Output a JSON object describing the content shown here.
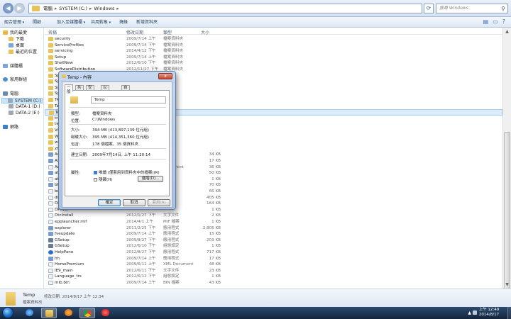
{
  "address": {
    "crumbs": [
      "電腦",
      "SYSTEM (C:)",
      "Windows"
    ],
    "search_placeholder": "搜尋 Windows"
  },
  "toolbar": {
    "items": [
      "組合管理",
      "開啟",
      "加入至媒體櫃",
      "共用對象",
      "燒錄",
      "新增資料夾"
    ]
  },
  "nav": {
    "favorites": "我的最愛",
    "fav_items": [
      "下載",
      "桌面",
      "最近的位置"
    ],
    "libraries": "媒體櫃",
    "homegroup": "家用群組",
    "computer": "電腦",
    "drives": [
      "SYSTEM (C:)",
      "DATA-1 (D:)",
      "DATA-2 (E:)"
    ],
    "network": "網路"
  },
  "columns": [
    "名稱",
    "修改日期",
    "類型",
    "大小"
  ],
  "files": [
    {
      "name": "security",
      "date": "2009/7/14 上午",
      "type": "檔案資料夾",
      "size": "",
      "icon": "folder"
    },
    {
      "name": "ServiceProfiles",
      "date": "2009/7/14 下午",
      "type": "檔案資料夾",
      "size": "",
      "icon": "folder"
    },
    {
      "name": "servicing",
      "date": "2014/4/12 下午",
      "type": "檔案資料夾",
      "size": "",
      "icon": "folder"
    },
    {
      "name": "Setup",
      "date": "2009/7/14 上午",
      "type": "檔案資料夾",
      "size": "",
      "icon": "folder"
    },
    {
      "name": "ShellNew",
      "date": "2012/6/10 下午",
      "type": "檔案資料夾",
      "size": "",
      "icon": "folder"
    },
    {
      "name": "SoftwareDistribution",
      "date": "2012/11/27 下午",
      "type": "檔案資料夾",
      "size": "",
      "icon": "folder"
    },
    {
      "name": "Speech",
      "date": "",
      "type": "",
      "size": "",
      "icon": "folder"
    },
    {
      "name": "System",
      "date": "",
      "type": "",
      "size": "",
      "icon": "folder"
    },
    {
      "name": "System32",
      "date": "",
      "type": "",
      "size": "",
      "icon": "folder"
    },
    {
      "name": "SysWOW64",
      "date": "",
      "type": "",
      "size": "",
      "icon": "folder"
    },
    {
      "name": "TAPI",
      "date": "",
      "type": "",
      "size": "",
      "icon": "folder"
    },
    {
      "name": "Tasks",
      "date": "",
      "type": "",
      "size": "",
      "icon": "folder"
    },
    {
      "name": "Temp",
      "date": "",
      "type": "",
      "size": "",
      "icon": "folder",
      "selected": true
    },
    {
      "name": "tracing",
      "date": "",
      "type": "",
      "size": "",
      "icon": "folder"
    },
    {
      "name": "twain_32",
      "date": "",
      "type": "",
      "size": "",
      "icon": "folder"
    },
    {
      "name": "Vss",
      "date": "",
      "type": "",
      "size": "",
      "icon": "folder"
    },
    {
      "name": "Web",
      "date": "",
      "type": "",
      "size": "",
      "icon": "folder"
    },
    {
      "name": "winsxs",
      "date": "",
      "type": "",
      "size": "",
      "icon": "folder"
    },
    {
      "name": "zh-TW",
      "date": "",
      "type": "",
      "size": "",
      "icon": "folder"
    },
    {
      "name": "AsCEF",
      "date": "",
      "type": "",
      "size": "34 KB",
      "icon": "exe"
    },
    {
      "name": "AsMbt",
      "date": "",
      "type": "",
      "size": "17 KB",
      "icon": "exe"
    },
    {
      "name": "Acc",
      "date": "",
      "type": "Document",
      "size": "36 KB",
      "icon": "txt"
    },
    {
      "name": "atac",
      "date": "",
      "type": "",
      "size": "50 KB",
      "icon": "exe"
    },
    {
      "name": "atgi",
      "date": "",
      "type": "",
      "size": "1 KB",
      "icon": "txt"
    },
    {
      "name": "bfsv",
      "date": "",
      "type": "",
      "size": "70 KB",
      "icon": "exe"
    },
    {
      "name": "bootstat",
      "date": "",
      "type": "",
      "size": "66 KB",
      "icon": "txt"
    },
    {
      "name": "diagerr",
      "date": "",
      "type": "",
      "size": "405 KB",
      "icon": "txt"
    },
    {
      "name": "DirectX",
      "date": "",
      "type": "",
      "size": "164 KB",
      "icon": "txt"
    },
    {
      "name": "DPINST",
      "date": "",
      "type": "",
      "size": "1 KB",
      "icon": "txt"
    },
    {
      "name": "DtcInstall",
      "date": "2012/1/27 下午",
      "type": "文字文件",
      "size": "2 KB",
      "icon": "txt"
    },
    {
      "name": "epplauncher.mif",
      "date": "2014/4/1 上午",
      "type": "MIF 檔案",
      "size": "1 KB",
      "icon": "txt"
    },
    {
      "name": "explorer",
      "date": "2011/2/25 下午",
      "type": "應用程式",
      "size": "2,805 KB",
      "icon": "exe"
    },
    {
      "name": "fveupdate",
      "date": "2009/7/14 上午",
      "type": "應用程式",
      "size": "15 KB",
      "icon": "exe"
    },
    {
      "name": "GSetup",
      "date": "2009/8/27 下午",
      "type": "應用程式",
      "size": "203 KB",
      "icon": "gear"
    },
    {
      "name": "GSetup",
      "date": "2012/6/10 下午",
      "type": "組態設定",
      "size": "1 KB",
      "icon": "gear"
    },
    {
      "name": "HelpPane",
      "date": "2012/8/27 下午",
      "type": "應用程式",
      "size": "717 KB",
      "icon": "help"
    },
    {
      "name": "hh",
      "date": "2009/7/14 上午",
      "type": "應用程式",
      "size": "17 KB",
      "icon": "exe"
    },
    {
      "name": "HomePremium",
      "date": "2009/6/11 上午",
      "type": "XML Document",
      "size": "48 KB",
      "icon": "txt"
    },
    {
      "name": "IE9_main",
      "date": "2012/6/11 下午",
      "type": "文字文件",
      "size": "23 KB",
      "icon": "txt"
    },
    {
      "name": "Language_trs",
      "date": "2012/6/12 下午",
      "type": "組態設定",
      "size": "1 KB",
      "icon": "txt"
    },
    {
      "name": "mib.bin",
      "date": "2009/7/14 上午",
      "type": "BIN 檔案",
      "size": "43 KB",
      "icon": "txt"
    }
  ],
  "details": {
    "name": "Temp",
    "type": "檔案資料夾",
    "modified_label": "修改日期:",
    "modified": "2014/8/17 上午 12:34"
  },
  "dialog": {
    "title": "Temp - 內容",
    "close": "x",
    "tabs": [
      "一般",
      "共用",
      "安全性",
      "以前的版本",
      "自訂"
    ],
    "name": "Temp",
    "rows": [
      {
        "label": "類型:",
        "value": "檔案資料夾"
      },
      {
        "label": "位置:",
        "value": "C:\\Windows"
      },
      {
        "label": "大小:",
        "value": "394 MB (413,897,139 位元組)"
      },
      {
        "label": "磁碟大小:",
        "value": "395 MB (414,351,360 位元組)"
      },
      {
        "label": "包含:",
        "value": "178 個檔案，35 個資料夾"
      },
      {
        "label": "建立日期:",
        "value": "2009年7月14日, 上午 11:20:14"
      }
    ],
    "attr_label": "屬性:",
    "readonly": "唯讀 (僅套用到資料夾中的檔案)(R)",
    "hidden": "隱藏(H)",
    "advanced": "進階(D)...",
    "ok": "確定",
    "cancel": "取消",
    "apply": "套用(A)"
  },
  "tray": {
    "time": "上午 12:49",
    "date": "2014/8/17"
  }
}
